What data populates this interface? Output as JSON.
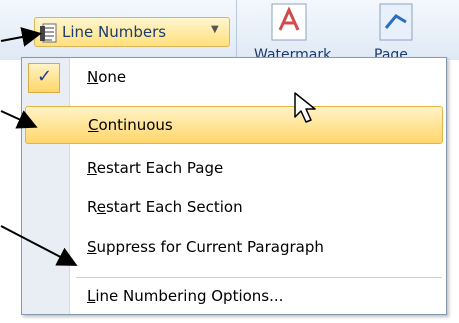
{
  "ribbon": {
    "items": [
      {
        "label": "Watermark",
        "icon": "watermark-icon"
      },
      {
        "label": "Page",
        "icon": "page-color-icon"
      }
    ]
  },
  "line_numbers_button": {
    "label": "Line Numbers",
    "icon": "line-numbers-icon",
    "caret": "chevron-down-icon"
  },
  "menu": {
    "items": [
      {
        "label": "None",
        "accel": "N",
        "rest": "one",
        "checked": true
      },
      {
        "label": "Continuous",
        "accel": "C",
        "rest": "ontinuous",
        "hovered": true
      },
      {
        "label": "Restart Each Page",
        "accel": "R",
        "rest": "estart Each Page"
      },
      {
        "label": "Restart Each Section",
        "pre": "R",
        "accel": "e",
        "rest": "start Each Section"
      },
      {
        "label": "Suppress for Current Paragraph",
        "accel": "S",
        "rest": "uppress for Current Paragraph"
      },
      {
        "label": "Line Numbering Options...",
        "accel": "L",
        "rest": "ine Numbering Options..."
      }
    ]
  },
  "check_symbol": "✓"
}
